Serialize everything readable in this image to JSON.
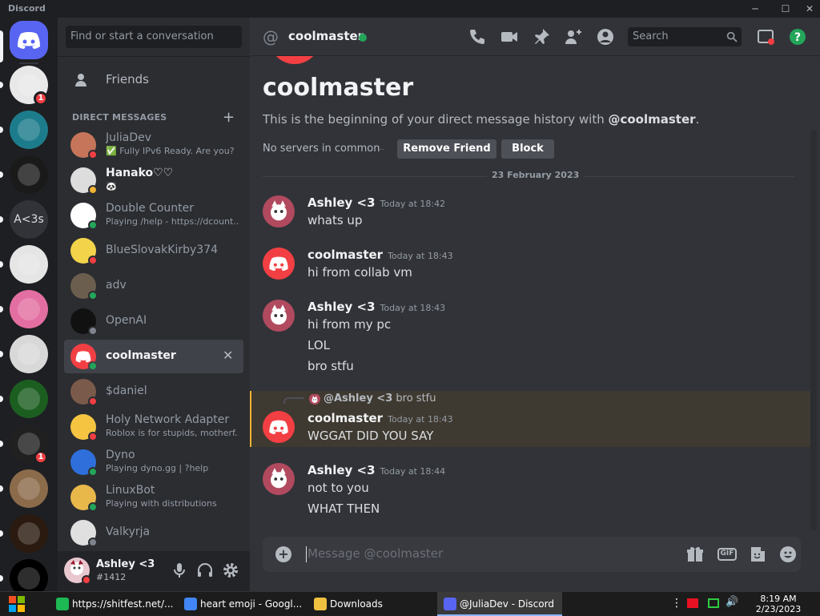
{
  "window": {
    "app_name": "Discord"
  },
  "servers": [
    {
      "name": "home",
      "color": "#5865f2",
      "badge": ""
    },
    {
      "name": "server-skull",
      "color": "#e8e8e8",
      "badge": "1"
    },
    {
      "name": "server-diamond",
      "color": "#1d7c8c",
      "badge": ""
    },
    {
      "name": "server-drg",
      "color": "#1a1a1a",
      "badge": ""
    },
    {
      "name": "A<3s",
      "color": "#313338",
      "badge": ""
    },
    {
      "name": "server-troll",
      "color": "#e5e5e5",
      "badge": ""
    },
    {
      "name": "server-pink",
      "color": "#e36fa2",
      "badge": ""
    },
    {
      "name": "server-sans",
      "color": "#d8d8d8",
      "badge": ""
    },
    {
      "name": "server-troll-green",
      "color": "#1b5e20",
      "badge": ""
    },
    {
      "name": "server-bot",
      "color": "#202020",
      "badge": "1"
    },
    {
      "name": "server-cat",
      "color": "#8b6b4a",
      "badge": ""
    },
    {
      "name": "server-ls",
      "color": "#2a1a0f",
      "badge": ""
    },
    {
      "name": "server-ph",
      "color": "#000000",
      "badge": ""
    }
  ],
  "sidebar": {
    "search_placeholder": "Find or start a conversation",
    "friends_label": "Friends",
    "dm_header": "DIRECT MESSAGES",
    "items": [
      {
        "name": "JuliaDev",
        "sub": "✅ Fully IPv6 Ready. Are you?",
        "status": "#f23f43",
        "color": "#c7755a",
        "bold": false
      },
      {
        "name": "Hanako♡♡",
        "sub": "🐼",
        "status": "#f0b232",
        "color": "#dddddd",
        "bold": true
      },
      {
        "name": "Double Counter",
        "sub": "Playing /help - https://dcount...",
        "status": "#23a55a",
        "color": "#ffffff",
        "bold": false
      },
      {
        "name": "BlueSlovakKirby374",
        "sub": "",
        "status": "#f23f43",
        "color": "#f3d34a",
        "bold": false
      },
      {
        "name": "adv",
        "sub": "",
        "status": "#23a55a",
        "color": "#6b5e4e",
        "bold": false
      },
      {
        "name": "OpenAI",
        "sub": "",
        "status": "#80848e",
        "color": "#111111",
        "bold": false
      },
      {
        "name": "coolmaster",
        "sub": "",
        "status": "#23a55a",
        "color": "#f23f43",
        "bold": true
      },
      {
        "name": "$daniel",
        "sub": "",
        "status": "#f23f43",
        "color": "#7a5a4a",
        "bold": false
      },
      {
        "name": "Holy Network Adapter",
        "sub": "Roblox is for stupids, motherf...",
        "status": "#f23f43",
        "color": "#f5c542",
        "bold": false
      },
      {
        "name": "Dyno",
        "sub": "Playing dyno.gg | ?help",
        "status": "#23a55a",
        "color": "#2f6fdb",
        "bold": false
      },
      {
        "name": "LinuxBot",
        "sub": "Playing with distributions",
        "status": "#23a55a",
        "color": "#e8b84a",
        "bold": false
      },
      {
        "name": "Valkyrja",
        "sub": "",
        "status": "#80848e",
        "color": "#e0e0e0",
        "bold": false
      }
    ],
    "close_glyph": "✕"
  },
  "user_panel": {
    "name": "Ashley <3",
    "tag": "#1412"
  },
  "chat": {
    "at_glyph": "@",
    "name": "coolmaster",
    "search_placeholder": "Search",
    "intro_title": "coolmaster",
    "intro_sub_prefix": "This is the beginning of your direct message history with ",
    "intro_sub_handle": "@coolmaster",
    "intro_sub_suffix": ".",
    "mutual": "No servers in common",
    "remove_friend": "Remove Friend",
    "block": "Block",
    "date": "23 February 2023",
    "messages": [
      {
        "author": "Ashley <3",
        "time": "Today at 18:42",
        "lines": [
          "whats up"
        ]
      },
      {
        "author": "coolmaster",
        "time": "Today at 18:43",
        "lines": [
          "hi from collab vm"
        ]
      },
      {
        "author": "Ashley <3",
        "time": "Today at 18:43",
        "lines": [
          "hi from my pc",
          "LOL",
          "bro stfu"
        ]
      },
      {
        "author": "coolmaster",
        "time": "Today at 18:43",
        "lines": [
          "WGGAT DID YOU SAY"
        ],
        "reply_to": "@Ashley <3",
        "reply_text": "bro stfu"
      },
      {
        "author": "Ashley <3",
        "time": "Today at 18:44",
        "lines": [
          "not to you",
          "WHAT THEN"
        ]
      }
    ],
    "composer_placeholder": "Message @coolmaster",
    "gif_label": "GIF",
    "plus_glyph": "+"
  },
  "taskbar": {
    "items": [
      {
        "label": "https://shitfest.net/...",
        "color": "#1db954"
      },
      {
        "label": "heart emoji - Googl...",
        "color": "#4285f4"
      },
      {
        "label": "Downloads",
        "color": "#f0c040"
      },
      {
        "label": "@JuliaDev - Discord",
        "color": "#5865f2"
      }
    ],
    "time": "8:19 AM",
    "date": "2/23/2023"
  },
  "colors": {
    "accent": "#5865f2",
    "online": "#23a55a",
    "dnd": "#f23f43",
    "idle": "#f0b232"
  }
}
